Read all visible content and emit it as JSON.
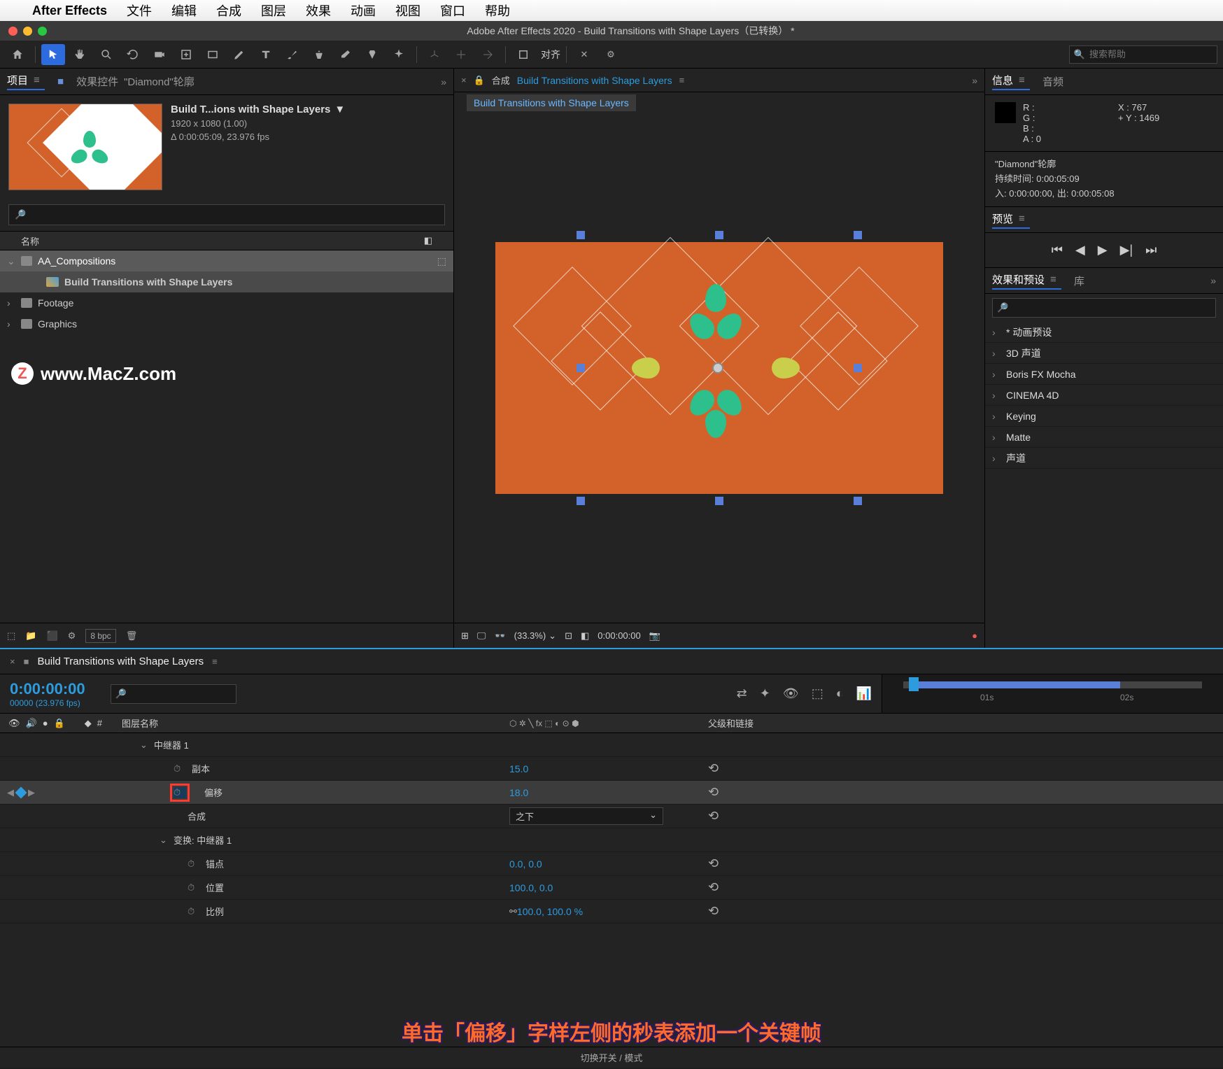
{
  "mac_menu": {
    "app": "After Effects",
    "items": [
      "文件",
      "编辑",
      "合成",
      "图层",
      "效果",
      "动画",
      "视图",
      "窗口",
      "帮助"
    ]
  },
  "window_title": "Adobe After Effects 2020 - Build Transitions with Shape Layers（已转换） *",
  "toolbar": {
    "align_label": "对齐",
    "search_placeholder": "搜索帮助"
  },
  "project": {
    "tab_project": "项目",
    "tab_effect_controls_prefix": "效果控件",
    "tab_effect_controls_name": "\"Diamond\"轮廓",
    "comp_name": "Build T...ions with Shape Layers",
    "comp_dims": "1920 x 1080 (1.00)",
    "comp_duration": "Δ 0:00:05:09, 23.976 fps",
    "col_name": "名称",
    "tree": {
      "folder1": "AA_Compositions",
      "comp1": "Build Transitions with Shape Layers",
      "folder2": "Footage",
      "folder3": "Graphics"
    },
    "watermark": "www.MacZ.com",
    "bpc": "8 bpc"
  },
  "comp_panel": {
    "prefix": "合成",
    "name": "Build Transitions with Shape Layers",
    "breadcrumb": "Build Transitions with Shape Layers",
    "zoom": "(33.3%)",
    "time": "0:00:00:00"
  },
  "info": {
    "tab_info": "信息",
    "tab_audio": "音频",
    "r": "R :",
    "g": "G :",
    "b": "B :",
    "a": "A :  0",
    "x": "X :  767",
    "y": "Y :  1469",
    "sel_name": "\"Diamond\"轮廓",
    "sel_duration": "持续时间: 0:00:05:09",
    "sel_inout": "入: 0:00:00:00, 出: 0:00:05:08"
  },
  "preview": {
    "tab": "预览"
  },
  "effects": {
    "tab_fx": "效果和预设",
    "tab_lib": "库",
    "rows": [
      "* 动画预设",
      "3D 声道",
      "Boris FX Mocha",
      "CINEMA 4D",
      "Keying",
      "Matte",
      "声道"
    ]
  },
  "timeline": {
    "tab": "Build Transitions with Shape Layers",
    "time": "0:00:00:00",
    "frames": "00000 (23.976 fps)",
    "col_layer": "图层名称",
    "col_parent": "父级和链接",
    "ruler_ticks": [
      "01s",
      "02s"
    ],
    "rows": {
      "repeater": "中继器 1",
      "copies_label": "副本",
      "copies_val": "15.0",
      "offset_label": "偏移",
      "offset_val": "18.0",
      "composite_label": "合成",
      "composite_val": "之下",
      "transform": "变换: 中继器 1",
      "anchor_label": "锚点",
      "anchor_val": "0.0, 0.0",
      "position_label": "位置",
      "position_val": "100.0, 0.0",
      "scale_label": "比例",
      "scale_val": "100.0, 100.0 %"
    },
    "footer": "切换开关 / 模式"
  },
  "annotation": "单击「偏移」字样左侧的秒表添加一个关键帧"
}
